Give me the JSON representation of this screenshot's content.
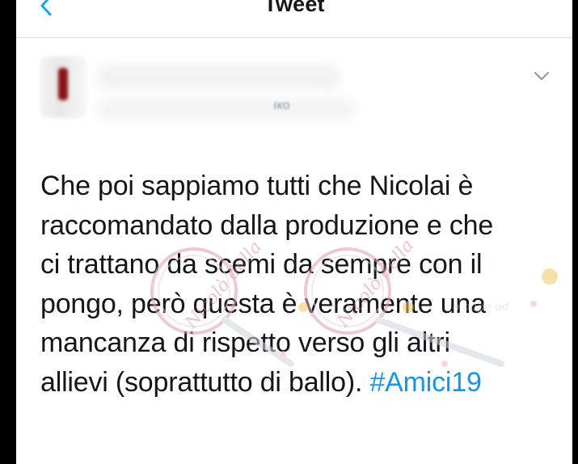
{
  "nav": {
    "title": "Tweet",
    "back_icon": "chevron-left-icon",
    "accent": "#1da1f2"
  },
  "author": {
    "handle_fragment": "ıко",
    "menu_icon": "chevron-down-icon"
  },
  "tweet": {
    "lines": [
      "Che poi sappiamo tutti che Nicolai è",
      "raccomandato dalla produzione e che",
      "ci trattano da scemi da sempre con il",
      "pongo, però questa è veramente una",
      "mancanza di rispetto verso gli altri",
      "allievi (soprattutto di ballo). "
    ],
    "hashtag": "#Amici19",
    "hashtag_color": "#1b95e0"
  },
  "watermark": {
    "text_left": "Nicolò della",
    "text_right": "Nicolò della",
    "script_text": "della",
    "trail_text": "o oupe od"
  }
}
